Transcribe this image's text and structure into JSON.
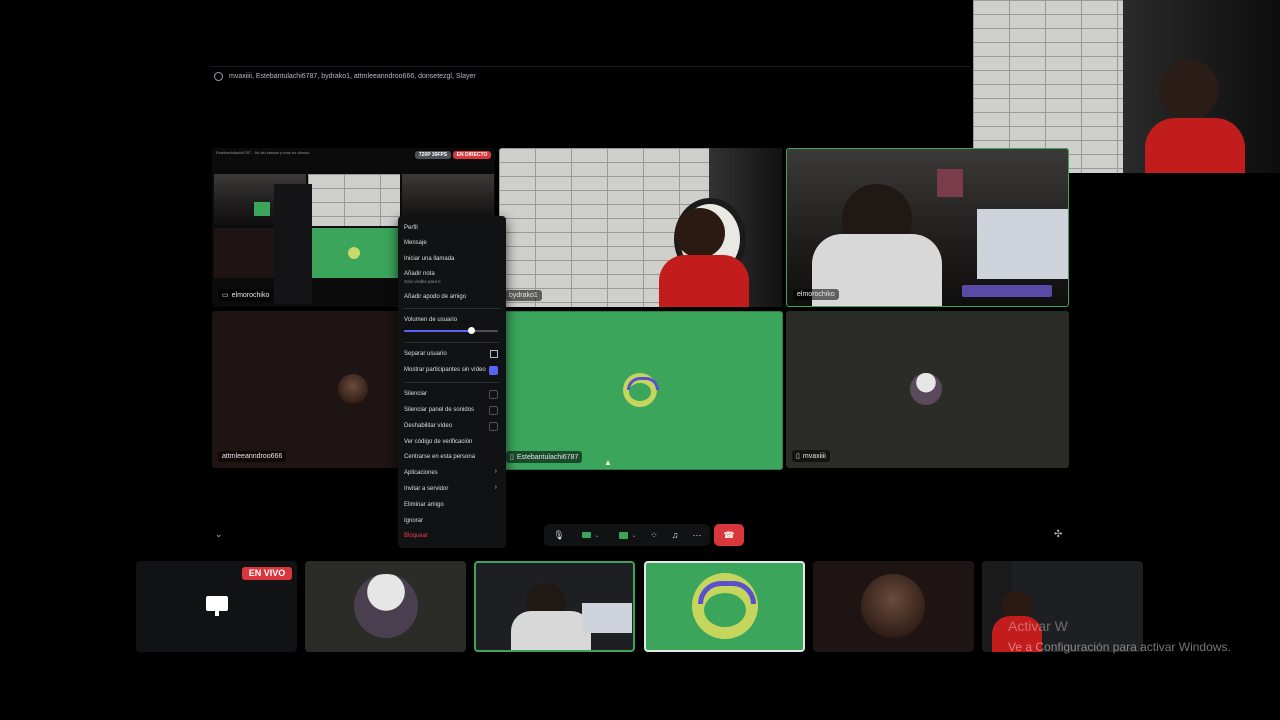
{
  "header": {
    "participants": "mvaxiiii, Estebantulachi6787, bydrako1, attmleeanndroo666, donsetezgl, Slayer"
  },
  "tiles": {
    "stream": {
      "label": "elmorochiko",
      "quality_badge": "720P 30FPS",
      "live_badge": "EN DIRECTO",
      "title": "Estebantulachi6787 - 6h del stream y mas en directo"
    },
    "bydrako": {
      "label": "bydrako1"
    },
    "elmorochiko": {
      "label": "elmorochiko"
    },
    "attm": {
      "label": "attmleeanndroo666"
    },
    "esteban": {
      "label": "Estebantulachi6787"
    },
    "mvaxiiii": {
      "label": "mvaxiiii"
    }
  },
  "context_menu": {
    "profile": "Perfil",
    "message": "Mensaje",
    "start_call": "Iniciar una llamada",
    "add_note": "Añadir nota",
    "add_note_hint": "Solo visible para ti",
    "add_nickname": "Añadir apodo de amigo",
    "volume_label": "Volumen de usuario",
    "volume_level": 0.72,
    "pop_out": "Separar usuario",
    "show_no_video": "Mostrar participantes sin vídeo",
    "mute": "Silenciar",
    "mute_soundboard": "Silenciar panel de sonidos",
    "disable_video": "Deshabilitar vídeo",
    "verification_code": "Ver código de verificación",
    "focus_person": "Centrarse en esta persona",
    "apps": "Aplicaciones",
    "invite_server": "Invitar a servidor",
    "remove_friend": "Eliminar amigo",
    "ignore": "Ignorar",
    "block": "Bloquear"
  },
  "bottom_strip": {
    "live_badge": "EN VIVO"
  },
  "watermark": {
    "line1": "Activar W",
    "line2": "Ve a Configuración para activar Windows."
  },
  "colors": {
    "accent": "#5865f2",
    "speaking": "#43a25a",
    "tile_green": "#3ba55c",
    "danger": "#da373c"
  }
}
